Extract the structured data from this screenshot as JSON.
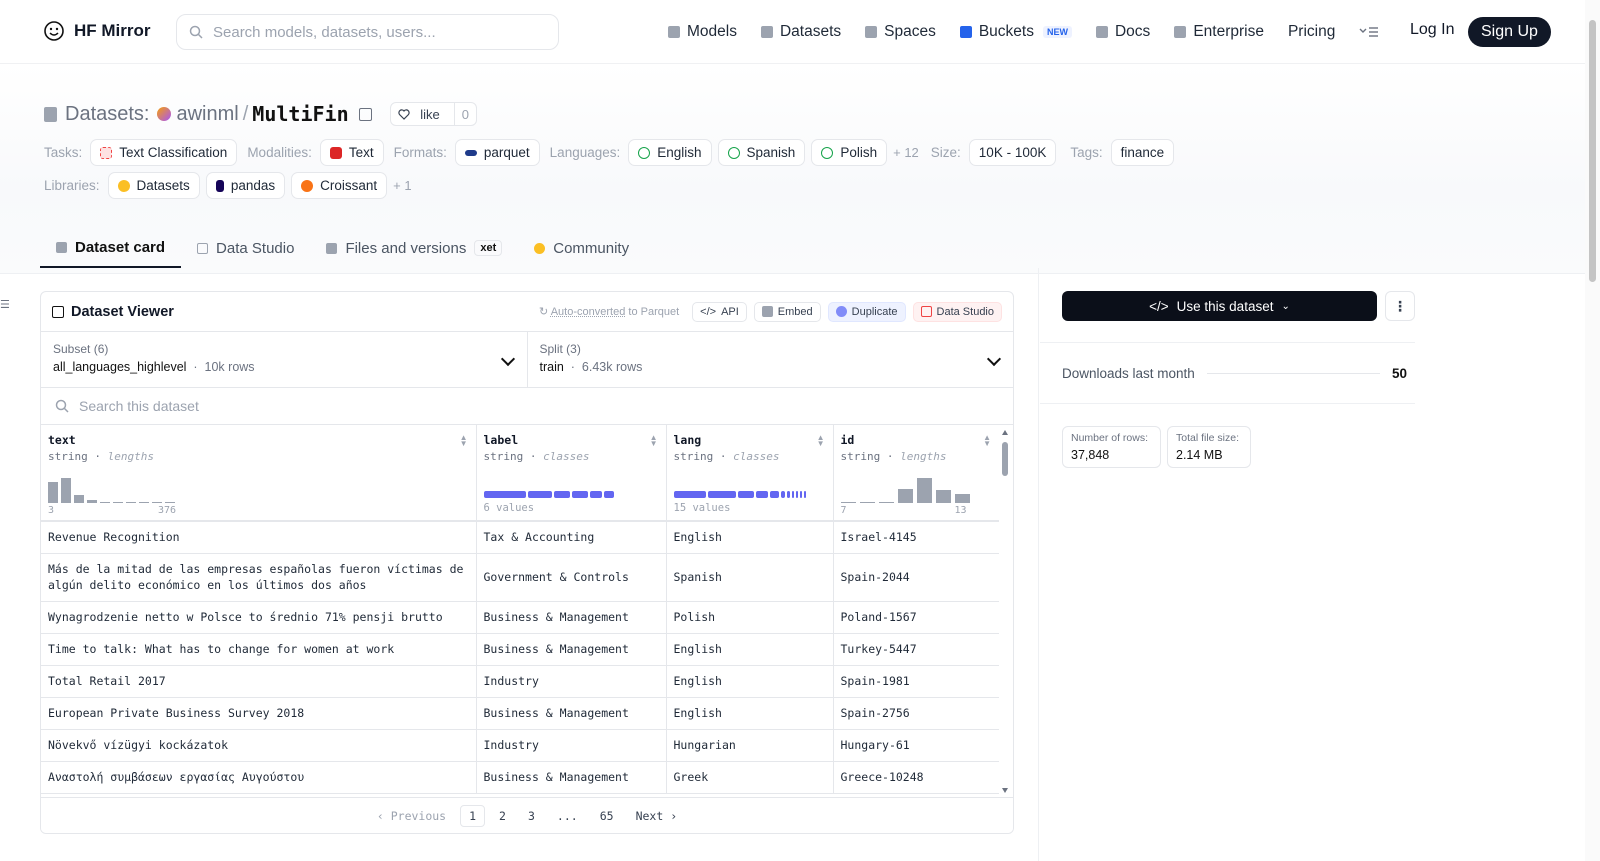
{
  "header": {
    "site_name": "HF Mirror",
    "search_placeholder": "Search models, datasets, users...",
    "nav": [
      {
        "label": "Models",
        "icon": "model-icon"
      },
      {
        "label": "Datasets",
        "icon": "dataset-icon"
      },
      {
        "label": "Spaces",
        "icon": "spaces-icon"
      },
      {
        "label": "Buckets",
        "icon": "bucket-icon",
        "badge": "NEW"
      },
      {
        "label": "Docs",
        "icon": "book-icon"
      },
      {
        "label": "Enterprise",
        "icon": "enterprise-icon"
      },
      {
        "label": "Pricing"
      }
    ],
    "login": "Log In",
    "signup": "Sign Up"
  },
  "title": {
    "prefix": "Datasets:",
    "owner": "awinml",
    "name": "MultiFin",
    "like_label": "like",
    "like_count": "0"
  },
  "tags": {
    "tasks_label": "Tasks:",
    "task": "Text Classification",
    "modalities_label": "Modalities:",
    "modality": "Text",
    "formats_label": "Formats:",
    "format": "parquet",
    "languages_label": "Languages:",
    "languages": [
      "English",
      "Spanish",
      "Polish"
    ],
    "languages_more": "+ 12",
    "size_label": "Size:",
    "size": "10K - 100K",
    "tags_label": "Tags:",
    "tag": "finance",
    "libraries_label": "Libraries:",
    "libraries": [
      "Datasets",
      "pandas",
      "Croissant"
    ],
    "libraries_more": "+ 1"
  },
  "tabs": [
    {
      "label": "Dataset card",
      "active": true
    },
    {
      "label": "Data Studio"
    },
    {
      "label": "Files and versions",
      "badge": "xet"
    },
    {
      "label": "Community"
    }
  ],
  "viewer": {
    "title": "Dataset Viewer",
    "autoconv_link": "Auto-converted",
    "autoconv_rest": "to Parquet",
    "buttons": [
      "API",
      "Embed",
      "Duplicate",
      "Data Studio"
    ],
    "subset_label": "Subset (6)",
    "subset_value": "all_languages_highlevel",
    "subset_rows": "10k rows",
    "split_label": "Split (3)",
    "split_value": "train",
    "split_rows": "6.43k rows",
    "search_placeholder": "Search this dataset",
    "columns": [
      {
        "name": "text",
        "type": "string",
        "stat": "lengths",
        "min": "3",
        "max": "376",
        "hist": [
          0.8,
          0.95,
          0.3,
          0.1,
          0.05,
          0.05,
          0.05,
          0,
          0.04,
          0.04
        ]
      },
      {
        "name": "label",
        "type": "string",
        "stat": "classes",
        "count_text": "6 values"
      },
      {
        "name": "lang",
        "type": "string",
        "stat": "classes",
        "count_text": "15 values"
      },
      {
        "name": "id",
        "type": "string",
        "stat": "lengths",
        "min": "7",
        "max": "13",
        "hist": [
          0.04,
          0.04,
          0.04,
          0.55,
          0.95,
          0.5,
          0.35
        ]
      }
    ],
    "rows": [
      [
        "Revenue Recognition",
        "Tax & Accounting",
        "English",
        "Israel-4145"
      ],
      [
        "Más de la mitad de las empresas españolas fueron víctimas de algún delito económico en los últimos dos años",
        "Government & Controls",
        "Spanish",
        "Spain-2044"
      ],
      [
        "Wynagrodzenie netto w Polsce to średnio 71% pensji brutto",
        "Business & Management",
        "Polish",
        "Poland-1567"
      ],
      [
        "Time to talk: What has to change for women at work",
        "Business & Management",
        "English",
        "Turkey-5447"
      ],
      [
        "Total Retail 2017",
        "Industry",
        "English",
        "Spain-1981"
      ],
      [
        "European Private Business Survey 2018",
        "Business & Management",
        "English",
        "Spain-2756"
      ],
      [
        "Növekvő vízügyi kockázatok",
        "Industry",
        "Hungarian",
        "Hungary-61"
      ],
      [
        "Αναστολή συμβάσεων εργασίας Αυγούστου",
        "Business & Management",
        "Greek",
        "Greece-10248"
      ]
    ],
    "pager": {
      "prev": "Previous",
      "pages": [
        "1",
        "2",
        "3",
        "...",
        "65"
      ],
      "next": "Next"
    }
  },
  "sidebar": {
    "use_button": "Use this dataset",
    "downloads_label": "Downloads last month",
    "downloads_value": "50",
    "rows_label": "Number of rows:",
    "rows_value": "37,848",
    "size_label": "Total file size:",
    "size_value": "2.14 MB"
  }
}
